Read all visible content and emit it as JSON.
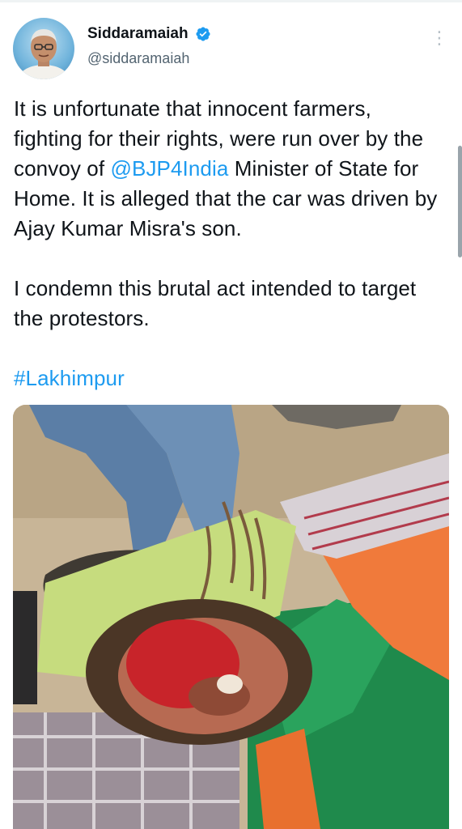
{
  "tweet": {
    "author": {
      "display_name": "Siddaramaiah",
      "handle": "@siddaramaiah",
      "verified": true,
      "avatar_icon": "profile-avatar"
    },
    "more_icon": "more-vertical-icon",
    "text": {
      "line1_pre": "It is unfortunate that innocent farmers, fighting for their rights, were run over by the convoy of ",
      "mention": "@BJP4India",
      "line1_post": " Minister of State for Home. It is alleged that the car was driven by  Ajay Kumar Misra's son.",
      "paragraph2": "I condemn this brutal act intended to target the protestors.",
      "hashtag": "#Lakhimpur"
    },
    "colors": {
      "link": "#1d9bf0",
      "text": "#0f1419",
      "secondary": "#536471"
    }
  }
}
